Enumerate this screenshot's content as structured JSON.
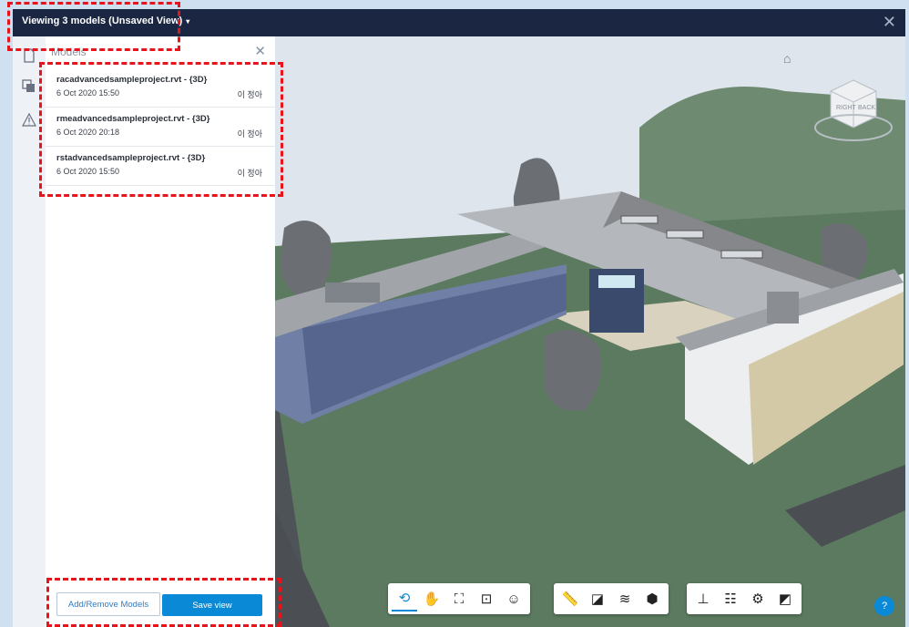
{
  "header": {
    "title": "Viewing 3 models (Unsaved View)",
    "dropdown_icon": "caret-down-icon",
    "close_icon": "close-icon"
  },
  "rail": {
    "icons": [
      "document-icon",
      "layers-icon",
      "warning-icon"
    ]
  },
  "panel": {
    "title": "Models",
    "models": [
      {
        "name": "racadvancedsampleproject.rvt - {3D}",
        "date": "6 Oct 2020 15:50",
        "user": "이 정아"
      },
      {
        "name": "rmeadvancedsampleproject.rvt - {3D}",
        "date": "6 Oct 2020 20:18",
        "user": "이 정아"
      },
      {
        "name": "rstadvancedsampleproject.rvt - {3D}",
        "date": "6 Oct 2020 15:50",
        "user": "이 정아"
      }
    ],
    "add_remove_label": "Add/Remove Models",
    "save_label": "Save view"
  },
  "viewcube": {
    "faces": [
      "RIGHT",
      "BACK"
    ]
  },
  "toolbar": {
    "groups": [
      [
        "orbit-icon",
        "pan-icon",
        "fit-to-view-icon",
        "zoom-window-icon",
        "first-person-icon"
      ],
      [
        "measure-icon",
        "section-icon",
        "layers-icon",
        "explode-icon"
      ],
      [
        "model-browser-icon",
        "properties-icon",
        "settings-icon",
        "fullscreen-icon"
      ]
    ]
  },
  "colors": {
    "header_bg": "#1b2742",
    "accent": "#0a8ad6",
    "ground": "#5a7a5e",
    "highlight": "#e8141c"
  }
}
